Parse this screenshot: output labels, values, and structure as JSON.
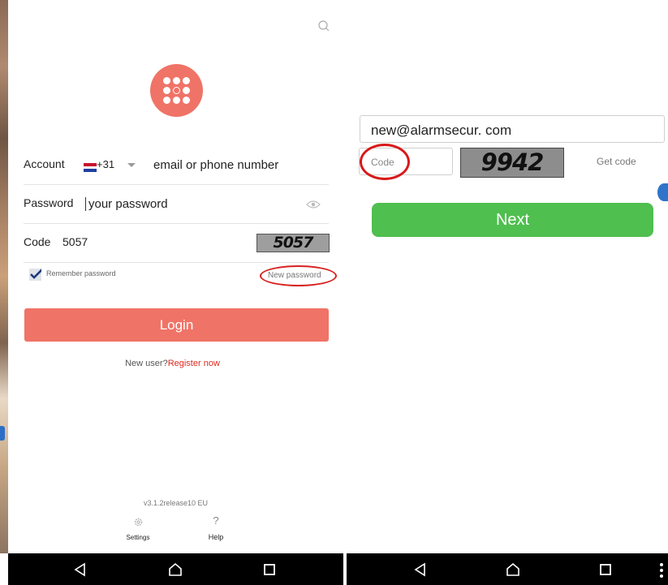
{
  "left_screen": {
    "account": {
      "label": "Account",
      "country_code": "+31",
      "placeholder": "email or phone number"
    },
    "password": {
      "label": "Password",
      "placeholder": "your password"
    },
    "code": {
      "label": "Code",
      "value": "5057",
      "captcha_text": "5057"
    },
    "remember": {
      "label": "Remember password",
      "checked": true
    },
    "new_password": "New password",
    "login_button": "Login",
    "register": {
      "prefix": "New user?",
      "link": "Register now"
    },
    "version": "v3.1.2release10 EU",
    "footer": {
      "settings": "Settings",
      "help": "Help",
      "help_glyph": "?"
    }
  },
  "right_screen": {
    "email_value": "new@alarmsecur. com",
    "code_placeholder": "Code",
    "captcha_text": "9942",
    "get_code": "Get code",
    "next_button": "Next"
  },
  "colors": {
    "brand": "#f07367",
    "next_green": "#4fbf4f",
    "link_red": "#e0291f",
    "annotation_red": "#d81919"
  },
  "icons": [
    "search-icon",
    "logo-dots-icon",
    "netherlands-flag-icon",
    "eye-icon",
    "checkmark-icon",
    "gear-icon",
    "help-icon",
    "back-icon",
    "home-icon",
    "recents-icon",
    "more-icon"
  ]
}
